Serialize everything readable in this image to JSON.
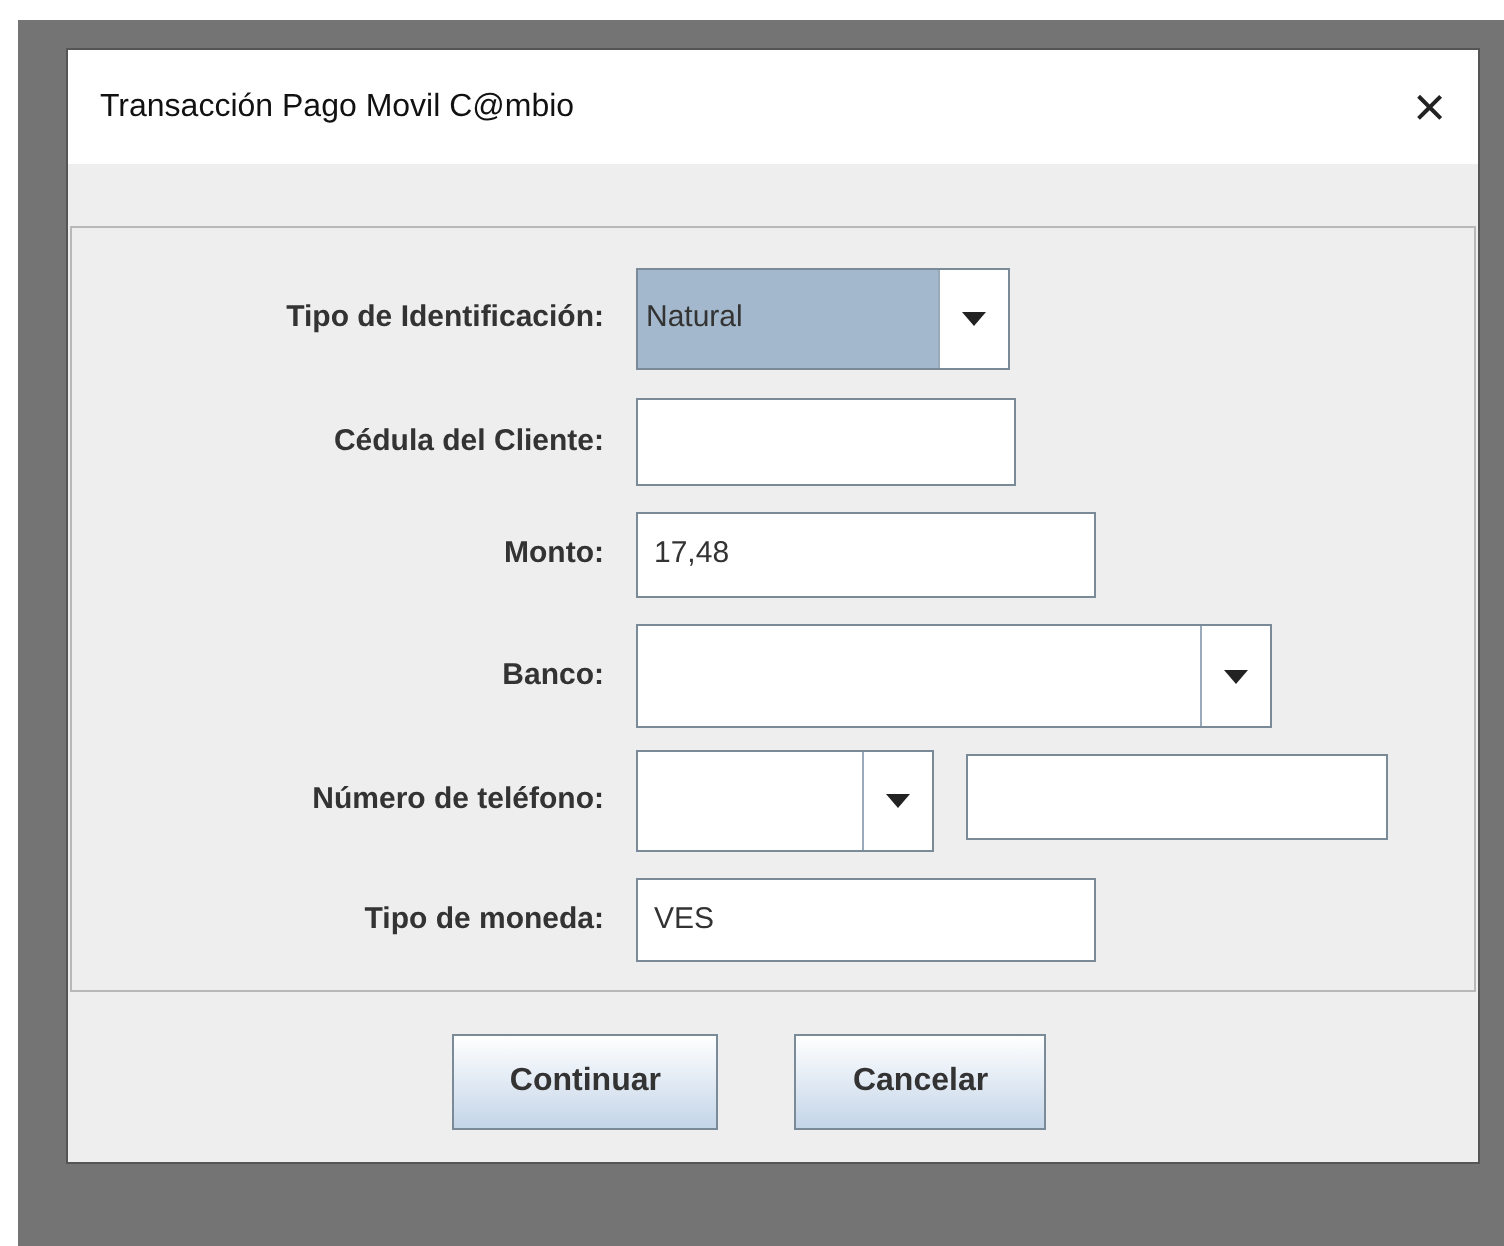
{
  "window": {
    "title": "Transacción Pago Movil C@mbio",
    "close": "×"
  },
  "fields": [
    {
      "label": "Tipo de Identificación:",
      "kind": "combo",
      "value": "Natural",
      "highlighted": true
    },
    {
      "label": "Cédula del Cliente:",
      "kind": "text"
    },
    {
      "label": "Monto:",
      "kind": "text",
      "value": "17,48"
    },
    {
      "label": "Banco:",
      "kind": "combo",
      "highlighted": false
    },
    {
      "label": "Número de teléfono:",
      "kind": "combo_text",
      "highlighted": false
    },
    {
      "label": "Tipo de moneda:",
      "kind": "text",
      "value": "VES"
    }
  ],
  "buttons": [
    "Continuar",
    "Cancelar"
  ]
}
